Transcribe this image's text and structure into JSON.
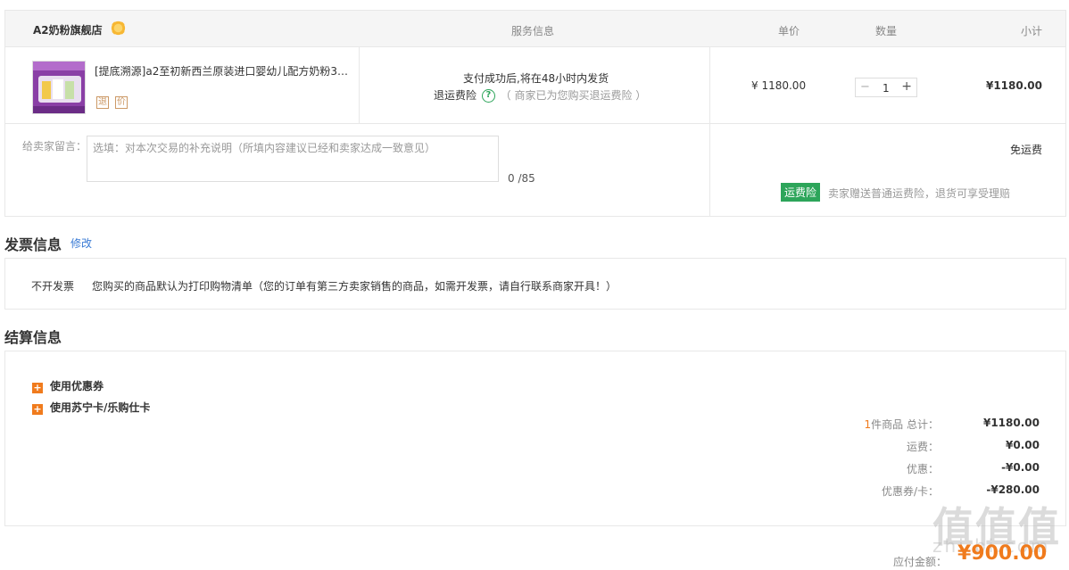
{
  "order": {
    "store_name": "A2奶粉旗舰店",
    "headers": {
      "service": "服务信息",
      "unit_price": "单价",
      "quantity": "数量",
      "subtotal": "小计"
    },
    "item": {
      "title": "[提底溯源]a2至初新西兰原装进口婴幼儿配方奶粉3…",
      "tag_return": "退",
      "tag_price": "价",
      "service_line1": "支付成功后,将在48小时内发货",
      "insurance_label": "退运费险",
      "insurance_note": "（ 商家已为您购买退运费险 ）",
      "unit_price": "¥ 1180.00",
      "quantity": "1",
      "subtotal": "¥1180.00"
    },
    "message": {
      "label": "给卖家留言：",
      "placeholder": "选填：对本次交易的补充说明（所填内容建议已经和卖家达成一致意见）",
      "count": "0 /85"
    },
    "shipping": {
      "free_label": "免运费",
      "insurance_badge": "运费险",
      "insurance_text": "卖家赠送普通运费险，退货可享受理赔"
    }
  },
  "invoice": {
    "title": "发票信息",
    "edit_link": "修改",
    "type": "不开发票",
    "desc": "您购买的商品默认为打印购物清单（您的订单有第三方卖家销售的商品，如需开发票，请自行联系商家开具！）"
  },
  "settlement": {
    "title": "结算信息",
    "option_coupon": "使用优惠券",
    "option_card": "使用苏宁卡/乐购仕卡",
    "summary": {
      "count": "1",
      "count_suffix": "件商品 总计：",
      "total": "¥1180.00",
      "shipping_label": "运费：",
      "shipping": "¥0.00",
      "discount_label": "优惠：",
      "discount": "-¥0.00",
      "coupon_label": "优惠券/卡：",
      "coupon": "-¥280.00"
    },
    "pay_label": "应付金额：",
    "pay_amount": "¥900.00"
  },
  "watermark": {
    "main": "值值值",
    "sub": "zhi.bi.com"
  },
  "colors": {
    "accent": "#f07b1d",
    "green": "#2da55a",
    "link": "#3a7bd5"
  }
}
